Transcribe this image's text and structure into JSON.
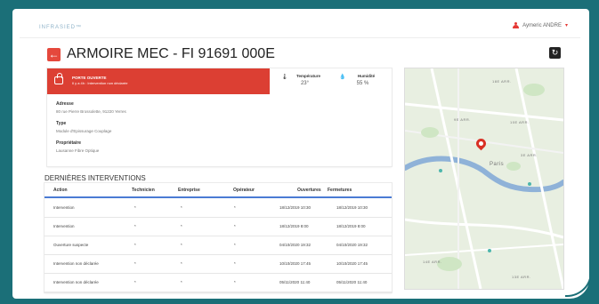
{
  "header": {
    "logo": "INFRASIED™",
    "user_name": "Aymeric ANDRE",
    "user_caret": "▾"
  },
  "page": {
    "back_icon": "←",
    "title": "ARMOIRE MEC - FI 91691 000E",
    "refresh_icon": "↻"
  },
  "status": {
    "title": "PORTE OUVERTE",
    "subtitle": "Il y a 4h : Intervention non déclarée",
    "accent_color": "#dc3f33"
  },
  "metrics": {
    "temperature_label": "Température",
    "temperature_value": "23°",
    "humidity_label": "Humidité",
    "humidity_value": "55 %"
  },
  "info": {
    "address_label": "Adresse",
    "address_value": "80 rue Pierre Brossolette, 91220 Yerres",
    "type_label": "Type",
    "type_value": "Module d'Epissurage Couplage",
    "owner_label": "Propriétaire",
    "owner_value": "Lausanne Fibre Optique"
  },
  "interventions": {
    "title": "DERNIÈRES INTERVENTIONS",
    "columns": [
      "Action",
      "Technicien",
      "Entreprise",
      "Opérateur",
      "Ouvertures",
      "Fermetures"
    ],
    "rows": [
      {
        "action": "Intervention",
        "technicien": "*",
        "entreprise": "*",
        "operateur": "*",
        "ouverture": "18/12/2019 10:30",
        "fermeture": "18/12/2019 10:30"
      },
      {
        "action": "Intervention",
        "technicien": "*",
        "entreprise": "*",
        "operateur": "*",
        "ouverture": "18/12/2019 8:00",
        "fermeture": "18/12/2019 8:00"
      },
      {
        "action": "Ouverture suspecte",
        "technicien": "*",
        "entreprise": "*",
        "operateur": "*",
        "ouverture": "04/10/2020 19:32",
        "fermeture": "04/10/2020 19:32"
      },
      {
        "action": "Intervention non déclarée",
        "technicien": "*",
        "entreprise": "*",
        "operateur": "*",
        "ouverture": "10/10/2020 17:45",
        "fermeture": "10/10/2020 17:45"
      },
      {
        "action": "Intervention non déclarée",
        "technicien": "*",
        "entreprise": "*",
        "operateur": "*",
        "ouverture": "05/11/2020 11:40",
        "fermeture": "05/11/2020 11:40"
      }
    ]
  },
  "map": {
    "labels": [
      "18E ARR.",
      "9E ARR.",
      "10E ARR.",
      "3E ARR.",
      "Paris",
      "14E ARR.",
      "13E ARR."
    ]
  }
}
